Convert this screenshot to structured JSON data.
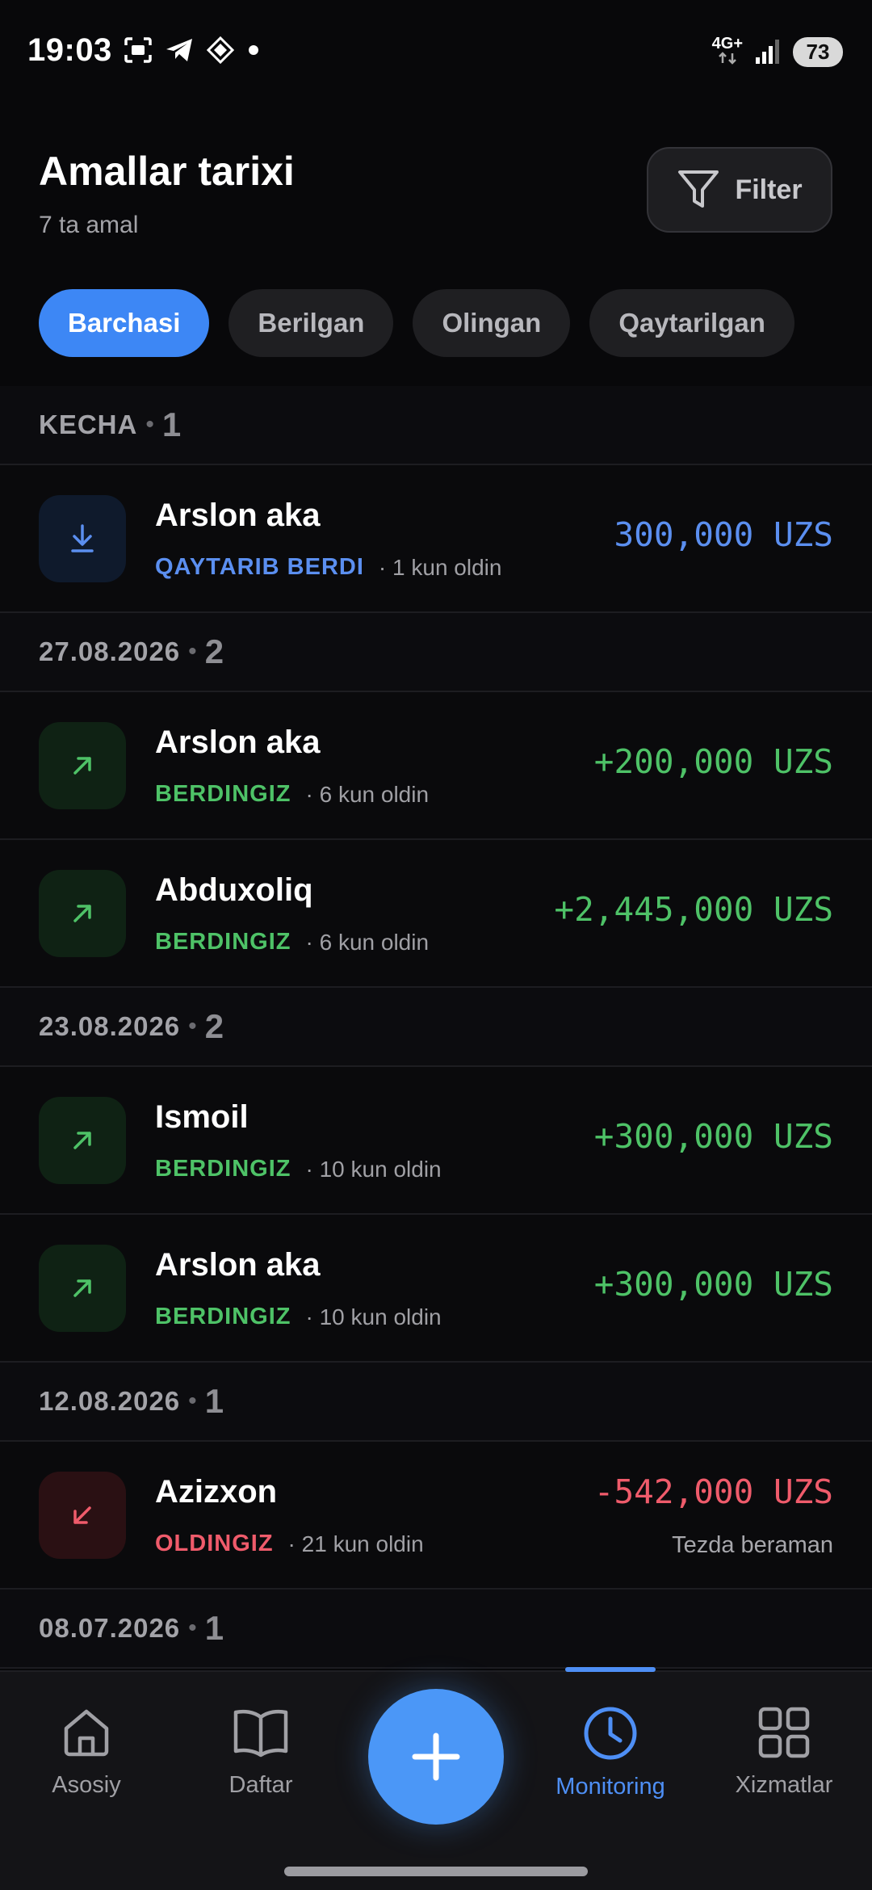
{
  "status_bar": {
    "time": "19:03",
    "network": "4G+",
    "battery": "73"
  },
  "header": {
    "title": "Amallar tarixi",
    "subtitle": "7 ta amal",
    "filter_label": "Filter"
  },
  "tabs": [
    {
      "label": "Barchasi",
      "active": true
    },
    {
      "label": "Berilgan",
      "active": false
    },
    {
      "label": "Olingan",
      "active": false
    },
    {
      "label": "Qaytarilgan",
      "active": false
    }
  ],
  "groups": [
    {
      "label": "KECHA",
      "count": "1",
      "items": [
        {
          "name": "Arslon aka",
          "status": "QAYTARIB BERDI",
          "time": "· 1 kun oldin",
          "amount": "300,000 UZS",
          "icon": "arrow-down-tray-icon",
          "color": "#5b8ff0"
        }
      ]
    },
    {
      "label": "27.08.2026",
      "count": "2",
      "items": [
        {
          "name": "Arslon aka",
          "status": "BERDINGIZ",
          "time": "· 6 kun oldin",
          "amount": "+200,000 UZS",
          "icon": "arrow-up-right-icon",
          "color": "#4ec267"
        },
        {
          "name": "Abduxoliq",
          "status": "BERDINGIZ",
          "time": "· 6 kun oldin",
          "amount": "+2,445,000 UZS",
          "icon": "arrow-up-right-icon",
          "color": "#4ec267"
        }
      ]
    },
    {
      "label": "23.08.2026",
      "count": "2",
      "items": [
        {
          "name": "Ismoil",
          "status": "BERDINGIZ",
          "time": "· 10 kun oldin",
          "amount": "+300,000 UZS",
          "icon": "arrow-up-right-icon",
          "color": "#4ec267"
        },
        {
          "name": "Arslon aka",
          "status": "BERDINGIZ",
          "time": "· 10 kun oldin",
          "amount": "+300,000 UZS",
          "icon": "arrow-up-right-icon",
          "color": "#4ec267"
        }
      ]
    },
    {
      "label": "12.08.2026",
      "count": "1",
      "items": [
        {
          "name": "Azizxon",
          "status": "OLDINGIZ",
          "time": "· 21 kun oldin",
          "amount": "-542,000 UZS",
          "note": "Tezda beraman",
          "icon": "arrow-down-left-icon",
          "color": "#ef5b6b"
        }
      ]
    },
    {
      "label": "08.07.2026",
      "count": "1",
      "items": []
    }
  ],
  "nav": [
    {
      "label": "Asosiy",
      "icon": "home-icon",
      "active": false
    },
    {
      "label": "Daftar",
      "icon": "book-icon",
      "active": false
    },
    {
      "label": "Monitoring",
      "icon": "clock-icon",
      "active": true
    },
    {
      "label": "Xizmatlar",
      "icon": "grid-icon",
      "active": false
    }
  ],
  "fab": {
    "icon": "plus-icon"
  },
  "colors": {
    "accent": "#3d87f5",
    "give": "#4ec267",
    "take": "#ef5b6b",
    "return": "#5b8ff0"
  }
}
